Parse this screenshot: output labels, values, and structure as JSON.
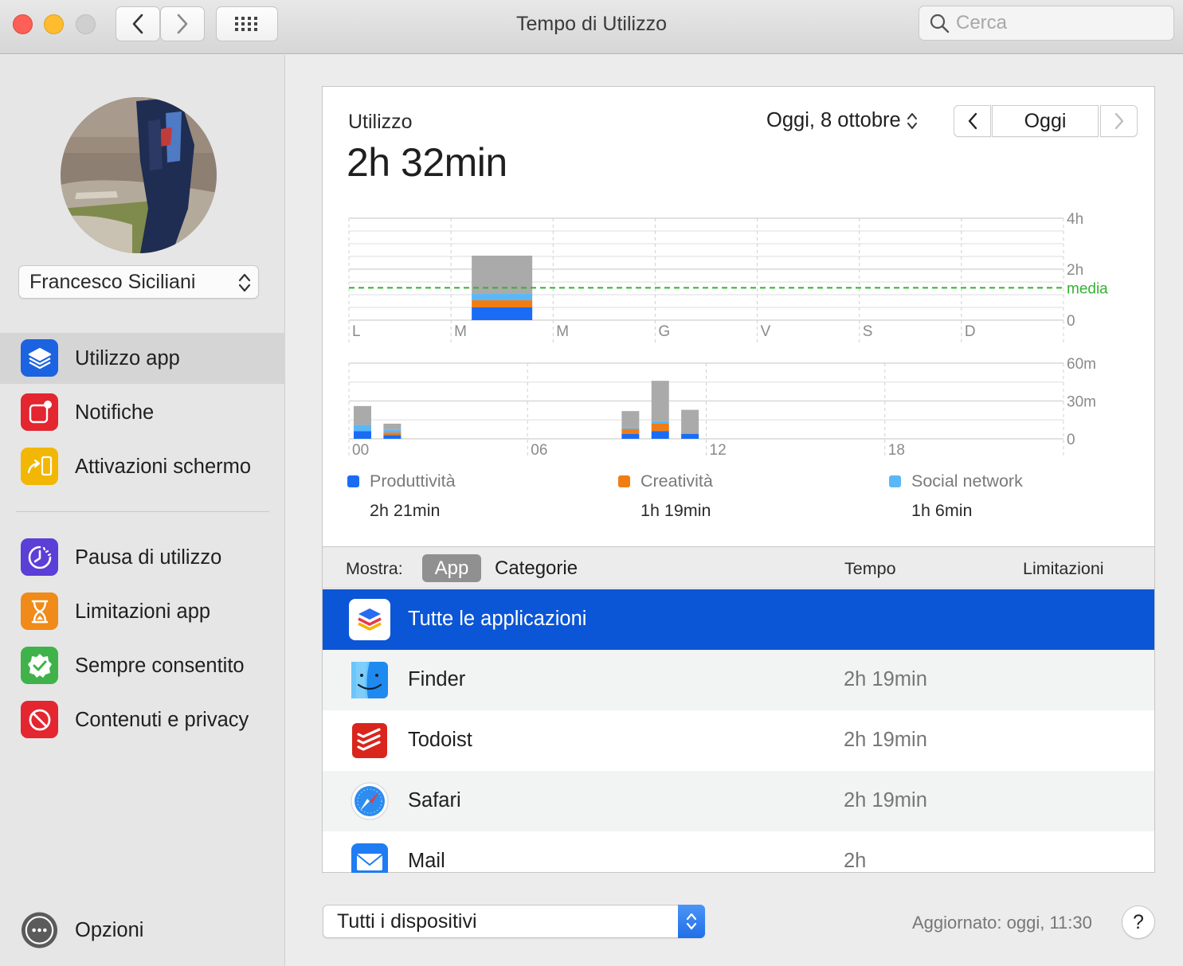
{
  "window": {
    "title": "Tempo di Utilizzo"
  },
  "search": {
    "placeholder": "Cerca"
  },
  "sidebar": {
    "user": "Francesco Siciliani",
    "items": [
      {
        "label": "Utilizzo app",
        "icon": "layers-icon",
        "color": "#1b63e0",
        "active": true
      },
      {
        "label": "Notifiche",
        "icon": "notification-badge-icon",
        "color": "#e3262f"
      },
      {
        "label": "Attivazioni schermo",
        "icon": "pickup-arrow-icon",
        "color": "#f2b705"
      },
      {
        "label": "Pausa di utilizzo",
        "icon": "downtime-clock-icon",
        "color": "#5b3fd6"
      },
      {
        "label": "Limitazioni app",
        "icon": "hourglass-icon",
        "color": "#f08a18"
      },
      {
        "label": "Sempre consentito",
        "icon": "checkmark-seal-icon",
        "color": "#3fb24a"
      },
      {
        "label": "Contenuti e privacy",
        "icon": "prohibited-icon",
        "color": "#e3262f"
      }
    ],
    "options": "Opzioni"
  },
  "usage": {
    "label": "Utilizzo",
    "total": "2h 32min",
    "date": "Oggi, 8 ottobre",
    "today_button": "Oggi"
  },
  "weekly_chart": {
    "days": [
      "L",
      "M",
      "M",
      "G",
      "V",
      "S",
      "D"
    ],
    "y_ticks": [
      "4h",
      "2h",
      "0"
    ],
    "average_label": "media"
  },
  "hourly_chart": {
    "x_ticks": [
      "00",
      "06",
      "12",
      "18"
    ],
    "y_ticks": [
      "60m",
      "30m",
      "0"
    ]
  },
  "chart_data": [
    {
      "type": "bar",
      "categories": [
        "L",
        "M",
        "M",
        "G",
        "V",
        "S",
        "D"
      ],
      "ylim": [
        0,
        4
      ],
      "series": [
        {
          "name": "Produttività",
          "color": "#1a6cf5",
          "values": [
            0,
            0.5,
            0,
            0,
            0,
            0,
            0
          ]
        },
        {
          "name": "Creatività",
          "color": "#f27c14",
          "values": [
            0,
            0.28,
            0,
            0,
            0,
            0,
            0
          ]
        },
        {
          "name": "Social network",
          "color": "#5ab8f7",
          "values": [
            0,
            0.25,
            0,
            0,
            0,
            0,
            0
          ]
        },
        {
          "name": "",
          "color": "#aaaaaa",
          "values": [
            0,
            1.5,
            0,
            0,
            0,
            0,
            0
          ]
        }
      ],
      "average": 1.27
    },
    {
      "type": "bar",
      "x_range": [
        0,
        24
      ],
      "ylim": [
        0,
        60
      ],
      "hours": [
        0,
        1,
        9,
        10,
        11
      ],
      "series": [
        {
          "name": "Produttività",
          "color": "#1a6cf5",
          "values": [
            6,
            3,
            4,
            6,
            4
          ]
        },
        {
          "name": "Creatività",
          "color": "#f27c14",
          "values": [
            0,
            2,
            4,
            6,
            0
          ]
        },
        {
          "name": "Social network",
          "color": "#5ab8f7",
          "values": [
            5,
            2,
            1,
            2,
            0
          ]
        },
        {
          "name": "",
          "color": "#aaaaaa",
          "values": [
            15,
            5,
            13,
            32,
            19
          ]
        }
      ]
    }
  ],
  "legend": [
    {
      "name": "Produttività",
      "time": "2h 21min",
      "color": "#1a6cf5"
    },
    {
      "name": "Creatività",
      "time": "1h 19min",
      "color": "#f27c14"
    },
    {
      "name": "Social network",
      "time": "1h 6min",
      "color": "#5ab8f7"
    }
  ],
  "list": {
    "show_label": "Mostra:",
    "seg_app": "App",
    "seg_categories": "Categorie",
    "col_time": "Tempo",
    "col_limits": "Limitazioni",
    "rows": [
      {
        "name": "Tutte le applicazioni",
        "time": "",
        "icon": "all-apps-icon"
      },
      {
        "name": "Finder",
        "time": "2h 19min",
        "icon": "finder-icon"
      },
      {
        "name": "Todoist",
        "time": "2h 19min",
        "icon": "todoist-icon"
      },
      {
        "name": "Safari",
        "time": "2h 19min",
        "icon": "safari-icon"
      },
      {
        "name": "Mail",
        "time": "2h",
        "icon": "mail-icon"
      }
    ]
  },
  "footer": {
    "devices": "Tutti i dispositivi",
    "updated": "Aggiornato: oggi, 11:30",
    "help": "?"
  }
}
